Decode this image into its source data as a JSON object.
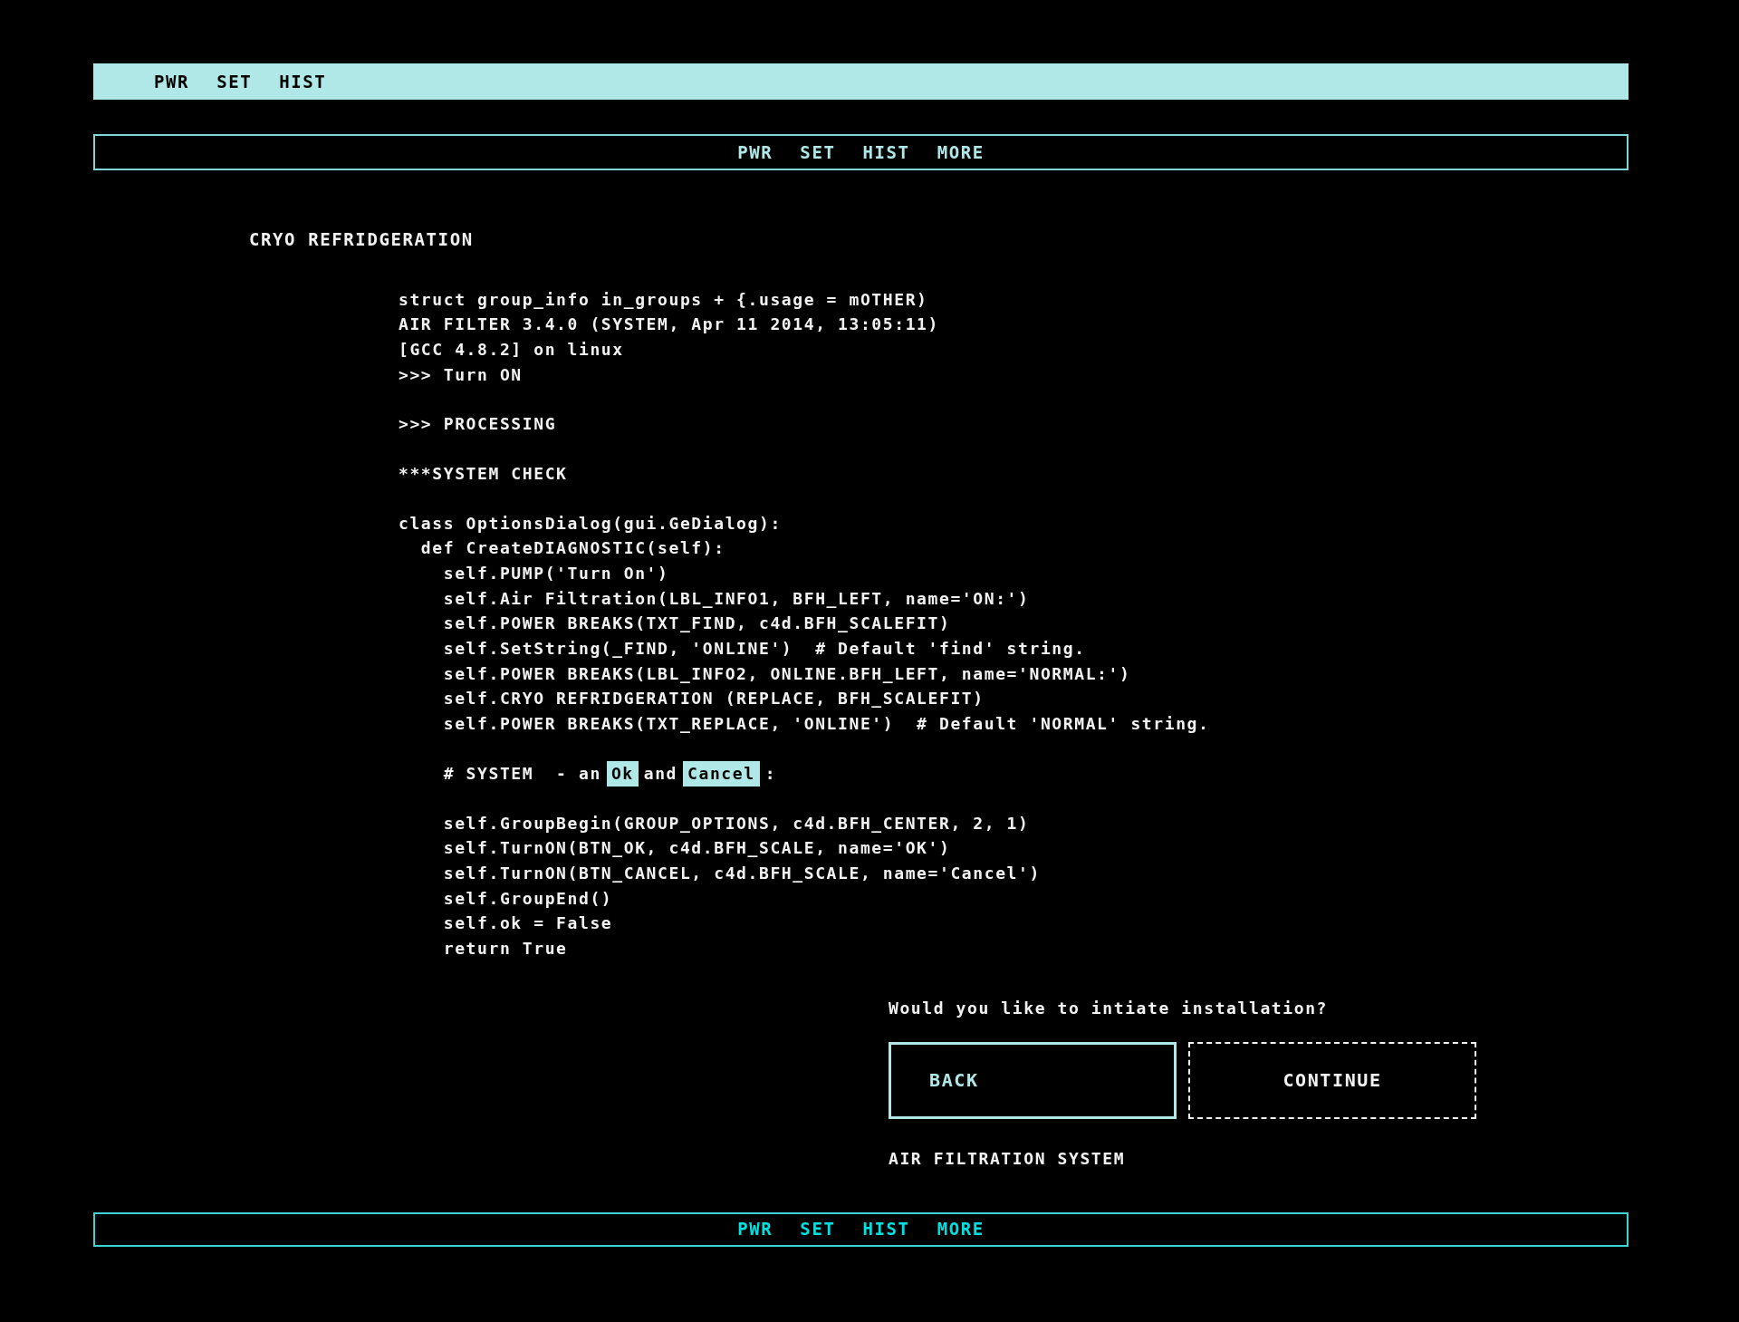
{
  "menu_bars": [
    {
      "kind": "filled",
      "items": [
        "PWR",
        "SET",
        "HIST"
      ]
    },
    {
      "kind": "outline",
      "items": [
        "PWR",
        "SET",
        "HIST",
        "MORE"
      ]
    }
  ],
  "section_title": "CRYO REFRIDGERATION",
  "code_blocks": [
    {
      "lines": [
        "struct group_info in_groups + {.usage = mOTHER)",
        "AIR FILTER 3.4.0 (SYSTEM, Apr 11 2014, 13:05:11)",
        "[GCC 4.8.2] on linux",
        ">>> Turn ON"
      ]
    },
    {
      "lines": [
        ">>> PROCESSING"
      ]
    },
    {
      "lines": [
        "***SYSTEM CHECK"
      ]
    },
    {
      "lines": [
        "class OptionsDialog(gui.GeDialog):",
        "  def CreateDIAGNOSTIC(self):",
        "    self.PUMP('Turn On')",
        "    self.Air Filtration(LBL_INFO1, BFH_LEFT, name='ON:')",
        "    self.POWER BREAKS(TXT_FIND, c4d.BFH_SCALEFIT)",
        "    self.SetString(_FIND, 'ONLINE')  # Default 'find' string.",
        "    self.POWER BREAKS(LBL_INFO2, ONLINE.BFH_LEFT, name='NORMAL:')",
        "    self.CRYO REFRIDGERATION (REPLACE, BFH_SCALEFIT)",
        "    self.POWER BREAKS(TXT_REPLACE, 'ONLINE')  # Default 'NORMAL' string."
      ]
    },
    {
      "segments": [
        {
          "text": "    # SYSTEM  - an",
          "highlighted": false
        },
        {
          "text": "Ok",
          "highlighted": true
        },
        {
          "text": "and",
          "highlighted": false
        },
        {
          "text": "Cancel",
          "highlighted": true
        },
        {
          "text": ":",
          "highlighted": false
        }
      ]
    },
    {
      "lines": [
        "    self.GroupBegin(GROUP_OPTIONS, c4d.BFH_CENTER, 2, 1)",
        "    self.TurnON(BTN_OK, c4d.BFH_SCALE, name='OK')",
        "    self.TurnON(BTN_CANCEL, c4d.BFH_SCALE, name='Cancel')",
        "    self.GroupEnd()",
        "    self.ok = False",
        "    return True"
      ]
    }
  ],
  "dialog": {
    "question": "Would you like to intiate installation?",
    "buttons": [
      {
        "label": "BACK",
        "selected": true
      },
      {
        "label": "CONTINUE",
        "selected": false
      }
    ],
    "footer": "AIR FILTRATION SYSTEM"
  },
  "bottom_bar": {
    "items": [
      "PWR",
      "SET",
      "HIST",
      "MORE"
    ]
  }
}
